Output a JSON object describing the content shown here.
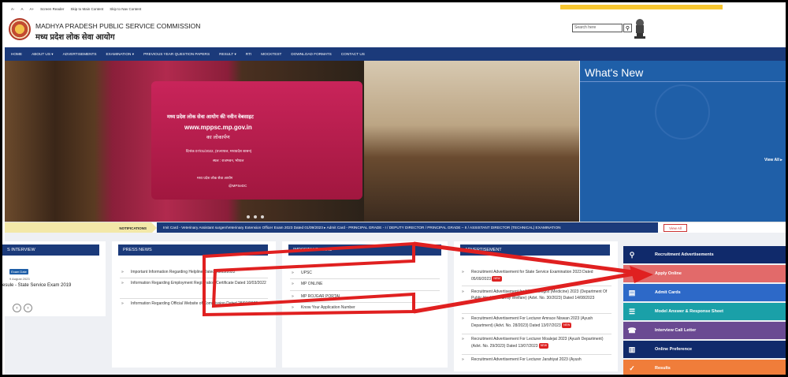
{
  "topbar": {
    "items": [
      "A-",
      "A",
      "A+",
      "Screen Reader",
      "Skip to Main Content",
      "Skip to Nav Content"
    ]
  },
  "header": {
    "title_en": "MADHYA PRADESH PUBLIC SERVICE COMMISSION",
    "title_hi": "मध्य प्रदेश लोक सेवा आयोग",
    "search_placeholder": "Search here",
    "search_icon": "search-icon"
  },
  "nav": [
    "HOME",
    "ABOUT US ▾",
    "ADVERTISEMENTS",
    "EXAMINATION ▾",
    "PREVIOUS YEAR QUESTION PAPERS",
    "RESULT ▾",
    "RTI",
    "MOCKTEST",
    "DOWNLOAD FORMATS",
    "CONTACT US"
  ],
  "slide": {
    "line1": "मध्य प्रदेश लोक सेवा आयोग की नवीन वेबसाइट",
    "line2": "www.mppsc.mp.gov.in",
    "line3": "का लोकार्पण",
    "line4": "दिनांक 07/01/2022, (राज्यपाल, मध्यप्रदेश शासन)",
    "line5": "स्थल : राजभवन, भोपाल",
    "line6": "मध्य प्रदेश लोक सेवा आयोग",
    "line7": "@MPSeDC"
  },
  "whatsnew": {
    "title": "What's New",
    "view_all": "View All ▸"
  },
  "notifications": {
    "label": "NOTIFICATIONS",
    "ticker": "Imit Card - Veterinary Assistant surgen/Veterinary Extension Officer Exam 2023 Dated 01/09/2023   ▸ Admit Card - PRINCIPAL GRADE - I / DEPUTY DIRECTOR / PRINCIPAL GRADE – II / ASSISTANT DIRECTOR (TECHNICAL) EXAMINATION",
    "view_all": "View All"
  },
  "interview": {
    "header": "S INTERVIEW",
    "badge": "Exam Date",
    "date": "9 August 2023",
    "text": "esule - State Service Exam 2019"
  },
  "press": {
    "header": "PRESS NEWS",
    "items": [
      "Important Information Regarding Helpline Dated 20/05/2022",
      "Information Regarding Employment Registration Certificate Dated 10/03/2022",
      "Information Regarding Official Website of Commission Dated 28/03/2022"
    ]
  },
  "links": {
    "header": "IMPORTANT LINKS",
    "items": [
      "UPSC",
      "MP ONLINE",
      "MP ROJGAR PORTAL",
      "Know Your Application Number"
    ]
  },
  "ads": {
    "header": "ADVERTISEMENT",
    "new": "NEW",
    "items": [
      "Recruitment Advertisement for State Service Examination 2023 Dated 05/09/2023",
      "Recruitment Advertisement for Microbiologist (Medicine) 2023 (Department Of Public Health & Family Welfare) (Advt. No. 30/2023) Dated 14/08/2023",
      "Recruitment Advertisement For Lecturer Amrace Niswan 2023 (Ayush Department) (Advt. No. 28/2023) Dated 13/07/2023",
      "Recruitment Advertisement For Lecturer Moalejat 2023 (Ayush Department) (Advt. No. 29/2023) Dated 13/07/2023",
      "Recruitment Advertisement For Lecturer Jarahiyat 2023 (Ayush"
    ]
  },
  "quick_links": [
    {
      "label": "Recruitment Advertisements",
      "color": "#102a6b",
      "icon": "⚲"
    },
    {
      "label": "Apply Online",
      "color": "#e26a6a",
      "icon": "✎"
    },
    {
      "label": "Admit Cards",
      "color": "#2d69c8",
      "icon": "▤"
    },
    {
      "label": "Model Answer & Response Sheet",
      "color": "#1aa0a8",
      "icon": "☰"
    },
    {
      "label": "Interview Call Letter",
      "color": "#6a4a92",
      "icon": "☎"
    },
    {
      "label": "Online Preference",
      "color": "#102a6b",
      "icon": "▥"
    },
    {
      "label": "Results",
      "color": "#f07d3a",
      "icon": "✓"
    }
  ],
  "annotation_color": "#e02020"
}
